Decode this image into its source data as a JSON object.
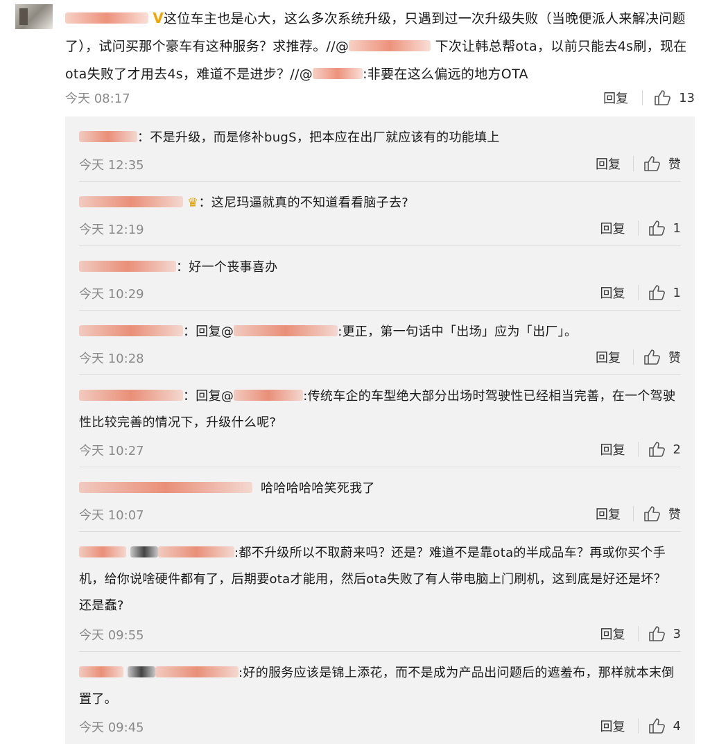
{
  "main_comment": {
    "text_1": "这位车主也是心大，这么多次系统升级，只遇到过一次升级失败（当晚便派人来解决问题了），试问买那个豪车有这种服务？求推荐。//@",
    "text_2": "下次让韩总帮ota，以前只能去4s刷，现在ota失败了才用去4s，难道不是进步？//@",
    "text_3": ":非要在这么偏远的地方OTA",
    "time": "今天 08:17",
    "reply_label": "回复",
    "like_count": "13"
  },
  "replies": [
    {
      "text": "：不是升级，而是修补bugS，把本应在出厂就应该有的功能填上",
      "time": "今天 12:35",
      "reply_label": "回复",
      "like": "赞"
    },
    {
      "text": "：这尼玛逼就真的不知道看看脑子去?",
      "time": "今天 12:19",
      "reply_label": "回复",
      "like": "1"
    },
    {
      "text": "：好一个丧事喜办",
      "time": "今天 10:29",
      "reply_label": "回复",
      "like": "1"
    },
    {
      "text_a": "：回复@",
      "text_b": ":更正，第一句话中「出场」应为「出厂」。",
      "time": "今天 10:28",
      "reply_label": "回复",
      "like": "赞"
    },
    {
      "text_a": "：回复@",
      "text_b": ":传统车企的车型绝大部分出场时驾驶性已经相当完善，在一个驾驶性比较完善的情况下，升级什么呢?",
      "time": "今天 10:27",
      "reply_label": "回复",
      "like": "2"
    },
    {
      "text": "哈哈哈哈哈笑死我了",
      "time": "今天 10:07",
      "reply_label": "回复",
      "like": "赞"
    },
    {
      "text": ":都不升级所以不取蔚来吗？还是？难道不是靠ota的半成品车？再或你买个手机，给你说啥硬件都有了，后期要ota才能用，然后ota失败了有人带电脑上门刷机，这到底是好还是坏？ 还是蠢?",
      "time": "今天 09:55",
      "reply_label": "回复",
      "like": "3"
    },
    {
      "text": ":好的服务应该是锦上添花，而不是成为产品出问题后的遮羞布，那样就本末倒置了。",
      "time": "今天 09:45",
      "reply_label": "回复",
      "like": "4"
    }
  ]
}
